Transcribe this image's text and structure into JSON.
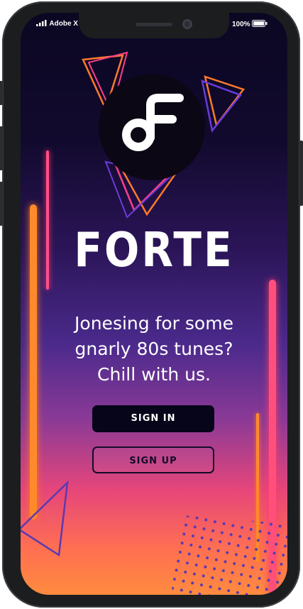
{
  "status_bar": {
    "carrier": "Adobe X",
    "battery": "100%"
  },
  "app": {
    "name": "FORTE",
    "logo_letter": "F"
  },
  "hero": {
    "tagline_lines": [
      "Jonesing for some",
      "gnarly 80s tunes?",
      "Chill with us."
    ]
  },
  "actions": {
    "sign_in_label": "SIGN IN",
    "sign_up_label": "SIGN UP"
  },
  "theme": {
    "accent_orange": "#ff8a2b",
    "accent_pink": "#ff4f7a",
    "accent_purple": "#5a3ab0",
    "button_dark": "#07051a"
  },
  "icons": {
    "logo": "music-note-f-logo-icon",
    "signal": "signal-bars-icon",
    "battery": "battery-icon"
  }
}
